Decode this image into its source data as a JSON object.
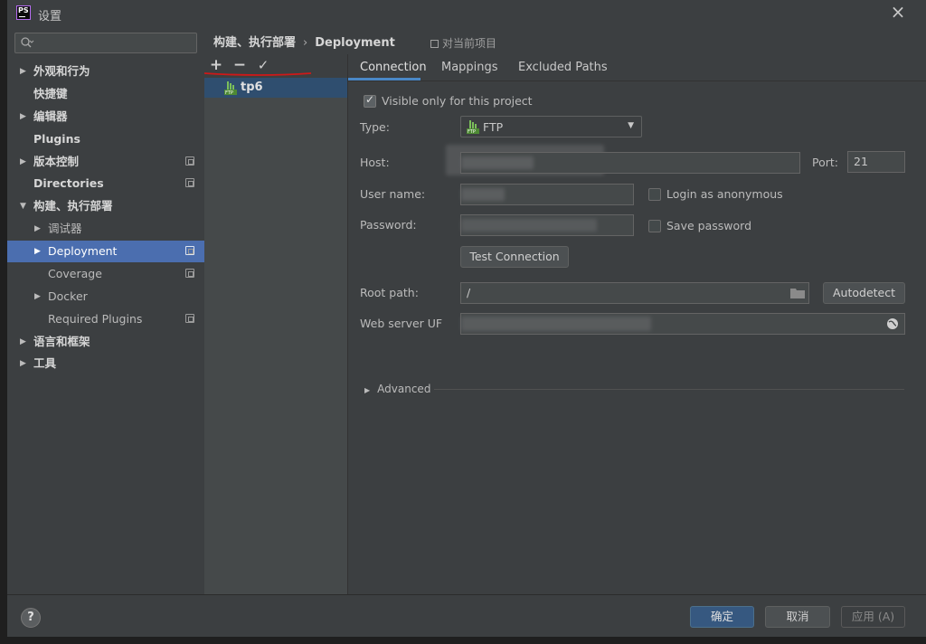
{
  "window": {
    "title": "设置",
    "logo_text": "PS"
  },
  "search": {
    "placeholder": ""
  },
  "tree": {
    "items": [
      {
        "label": "外观和行为"
      },
      {
        "label": "快捷键"
      },
      {
        "label": "编辑器"
      },
      {
        "label": "Plugins"
      },
      {
        "label": "版本控制"
      },
      {
        "label": "Directories"
      },
      {
        "label": "构建、执行部署"
      },
      {
        "label": "调试器"
      },
      {
        "label": "Deployment"
      },
      {
        "label": "Coverage"
      },
      {
        "label": "Docker"
      },
      {
        "label": "Required Plugins"
      },
      {
        "label": "语言和框架"
      },
      {
        "label": "工具"
      }
    ]
  },
  "breadcrumb": {
    "parent": "构建、执行部署",
    "separator": "›",
    "current": "Deployment"
  },
  "scope_label": "对当前项目",
  "toolbar": {
    "add": "+",
    "remove": "−",
    "check": "✓"
  },
  "servers": [
    {
      "name": "tp6",
      "icon": "ftp-server-icon"
    }
  ],
  "tabs": [
    "Connection",
    "Mappings",
    "Excluded Paths"
  ],
  "form": {
    "visible_only": "Visible only for this project",
    "type_label": "Type:",
    "type_value": "FTP",
    "host_label": "Host:",
    "port_label": "Port:",
    "port_value": "21",
    "user_label": "User name:",
    "anon_label": "Login as anonymous",
    "password_label": "Password:",
    "save_password_label": "Save password",
    "test_connection": "Test Connection",
    "root_label": "Root path:",
    "root_value": "/",
    "autodetect": "Autodetect",
    "web_server_label": "Web server UF",
    "advanced": "Advanced"
  },
  "footer": {
    "help": "?",
    "ok": "确定",
    "cancel": "取消",
    "apply": "应用 (A)"
  },
  "colors": {
    "selection": "#4b6eaf",
    "server_selection": "#2f4e6f",
    "ok_button": "#365880",
    "tab_underline": "#4a88c7"
  }
}
